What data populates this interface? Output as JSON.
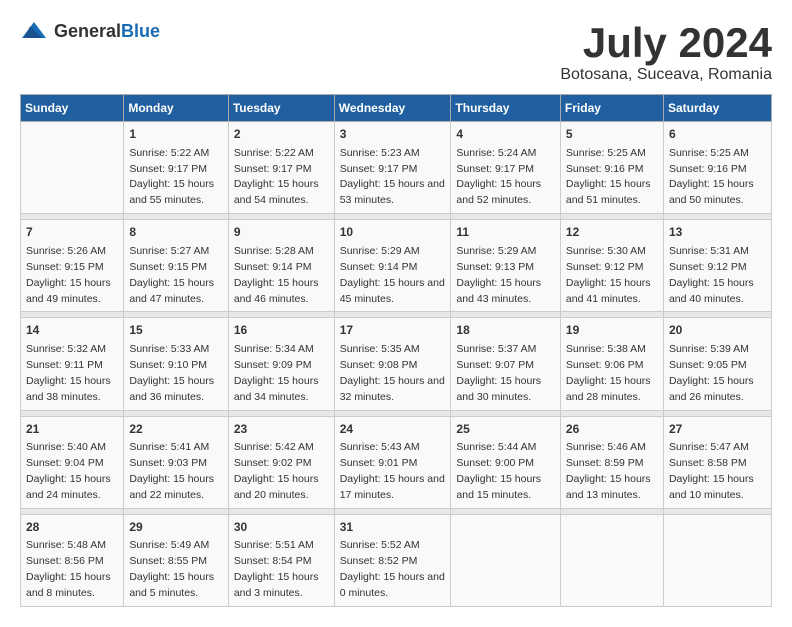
{
  "logo": {
    "general": "General",
    "blue": "Blue"
  },
  "title": "July 2024",
  "subtitle": "Botosana, Suceava, Romania",
  "days": [
    "Sunday",
    "Monday",
    "Tuesday",
    "Wednesday",
    "Thursday",
    "Friday",
    "Saturday"
  ],
  "weeks": [
    [
      {
        "date": "",
        "sunrise": "",
        "sunset": "",
        "daylight": ""
      },
      {
        "date": "1",
        "sunrise": "Sunrise: 5:22 AM",
        "sunset": "Sunset: 9:17 PM",
        "daylight": "Daylight: 15 hours and 55 minutes."
      },
      {
        "date": "2",
        "sunrise": "Sunrise: 5:22 AM",
        "sunset": "Sunset: 9:17 PM",
        "daylight": "Daylight: 15 hours and 54 minutes."
      },
      {
        "date": "3",
        "sunrise": "Sunrise: 5:23 AM",
        "sunset": "Sunset: 9:17 PM",
        "daylight": "Daylight: 15 hours and 53 minutes."
      },
      {
        "date": "4",
        "sunrise": "Sunrise: 5:24 AM",
        "sunset": "Sunset: 9:17 PM",
        "daylight": "Daylight: 15 hours and 52 minutes."
      },
      {
        "date": "5",
        "sunrise": "Sunrise: 5:25 AM",
        "sunset": "Sunset: 9:16 PM",
        "daylight": "Daylight: 15 hours and 51 minutes."
      },
      {
        "date": "6",
        "sunrise": "Sunrise: 5:25 AM",
        "sunset": "Sunset: 9:16 PM",
        "daylight": "Daylight: 15 hours and 50 minutes."
      }
    ],
    [
      {
        "date": "7",
        "sunrise": "Sunrise: 5:26 AM",
        "sunset": "Sunset: 9:15 PM",
        "daylight": "Daylight: 15 hours and 49 minutes."
      },
      {
        "date": "8",
        "sunrise": "Sunrise: 5:27 AM",
        "sunset": "Sunset: 9:15 PM",
        "daylight": "Daylight: 15 hours and 47 minutes."
      },
      {
        "date": "9",
        "sunrise": "Sunrise: 5:28 AM",
        "sunset": "Sunset: 9:14 PM",
        "daylight": "Daylight: 15 hours and 46 minutes."
      },
      {
        "date": "10",
        "sunrise": "Sunrise: 5:29 AM",
        "sunset": "Sunset: 9:14 PM",
        "daylight": "Daylight: 15 hours and 45 minutes."
      },
      {
        "date": "11",
        "sunrise": "Sunrise: 5:29 AM",
        "sunset": "Sunset: 9:13 PM",
        "daylight": "Daylight: 15 hours and 43 minutes."
      },
      {
        "date": "12",
        "sunrise": "Sunrise: 5:30 AM",
        "sunset": "Sunset: 9:12 PM",
        "daylight": "Daylight: 15 hours and 41 minutes."
      },
      {
        "date": "13",
        "sunrise": "Sunrise: 5:31 AM",
        "sunset": "Sunset: 9:12 PM",
        "daylight": "Daylight: 15 hours and 40 minutes."
      }
    ],
    [
      {
        "date": "14",
        "sunrise": "Sunrise: 5:32 AM",
        "sunset": "Sunset: 9:11 PM",
        "daylight": "Daylight: 15 hours and 38 minutes."
      },
      {
        "date": "15",
        "sunrise": "Sunrise: 5:33 AM",
        "sunset": "Sunset: 9:10 PM",
        "daylight": "Daylight: 15 hours and 36 minutes."
      },
      {
        "date": "16",
        "sunrise": "Sunrise: 5:34 AM",
        "sunset": "Sunset: 9:09 PM",
        "daylight": "Daylight: 15 hours and 34 minutes."
      },
      {
        "date": "17",
        "sunrise": "Sunrise: 5:35 AM",
        "sunset": "Sunset: 9:08 PM",
        "daylight": "Daylight: 15 hours and 32 minutes."
      },
      {
        "date": "18",
        "sunrise": "Sunrise: 5:37 AM",
        "sunset": "Sunset: 9:07 PM",
        "daylight": "Daylight: 15 hours and 30 minutes."
      },
      {
        "date": "19",
        "sunrise": "Sunrise: 5:38 AM",
        "sunset": "Sunset: 9:06 PM",
        "daylight": "Daylight: 15 hours and 28 minutes."
      },
      {
        "date": "20",
        "sunrise": "Sunrise: 5:39 AM",
        "sunset": "Sunset: 9:05 PM",
        "daylight": "Daylight: 15 hours and 26 minutes."
      }
    ],
    [
      {
        "date": "21",
        "sunrise": "Sunrise: 5:40 AM",
        "sunset": "Sunset: 9:04 PM",
        "daylight": "Daylight: 15 hours and 24 minutes."
      },
      {
        "date": "22",
        "sunrise": "Sunrise: 5:41 AM",
        "sunset": "Sunset: 9:03 PM",
        "daylight": "Daylight: 15 hours and 22 minutes."
      },
      {
        "date": "23",
        "sunrise": "Sunrise: 5:42 AM",
        "sunset": "Sunset: 9:02 PM",
        "daylight": "Daylight: 15 hours and 20 minutes."
      },
      {
        "date": "24",
        "sunrise": "Sunrise: 5:43 AM",
        "sunset": "Sunset: 9:01 PM",
        "daylight": "Daylight: 15 hours and 17 minutes."
      },
      {
        "date": "25",
        "sunrise": "Sunrise: 5:44 AM",
        "sunset": "Sunset: 9:00 PM",
        "daylight": "Daylight: 15 hours and 15 minutes."
      },
      {
        "date": "26",
        "sunrise": "Sunrise: 5:46 AM",
        "sunset": "Sunset: 8:59 PM",
        "daylight": "Daylight: 15 hours and 13 minutes."
      },
      {
        "date": "27",
        "sunrise": "Sunrise: 5:47 AM",
        "sunset": "Sunset: 8:58 PM",
        "daylight": "Daylight: 15 hours and 10 minutes."
      }
    ],
    [
      {
        "date": "28",
        "sunrise": "Sunrise: 5:48 AM",
        "sunset": "Sunset: 8:56 PM",
        "daylight": "Daylight: 15 hours and 8 minutes."
      },
      {
        "date": "29",
        "sunrise": "Sunrise: 5:49 AM",
        "sunset": "Sunset: 8:55 PM",
        "daylight": "Daylight: 15 hours and 5 minutes."
      },
      {
        "date": "30",
        "sunrise": "Sunrise: 5:51 AM",
        "sunset": "Sunset: 8:54 PM",
        "daylight": "Daylight: 15 hours and 3 minutes."
      },
      {
        "date": "31",
        "sunrise": "Sunrise: 5:52 AM",
        "sunset": "Sunset: 8:52 PM",
        "daylight": "Daylight: 15 hours and 0 minutes."
      },
      {
        "date": "",
        "sunrise": "",
        "sunset": "",
        "daylight": ""
      },
      {
        "date": "",
        "sunrise": "",
        "sunset": "",
        "daylight": ""
      },
      {
        "date": "",
        "sunrise": "",
        "sunset": "",
        "daylight": ""
      }
    ]
  ]
}
